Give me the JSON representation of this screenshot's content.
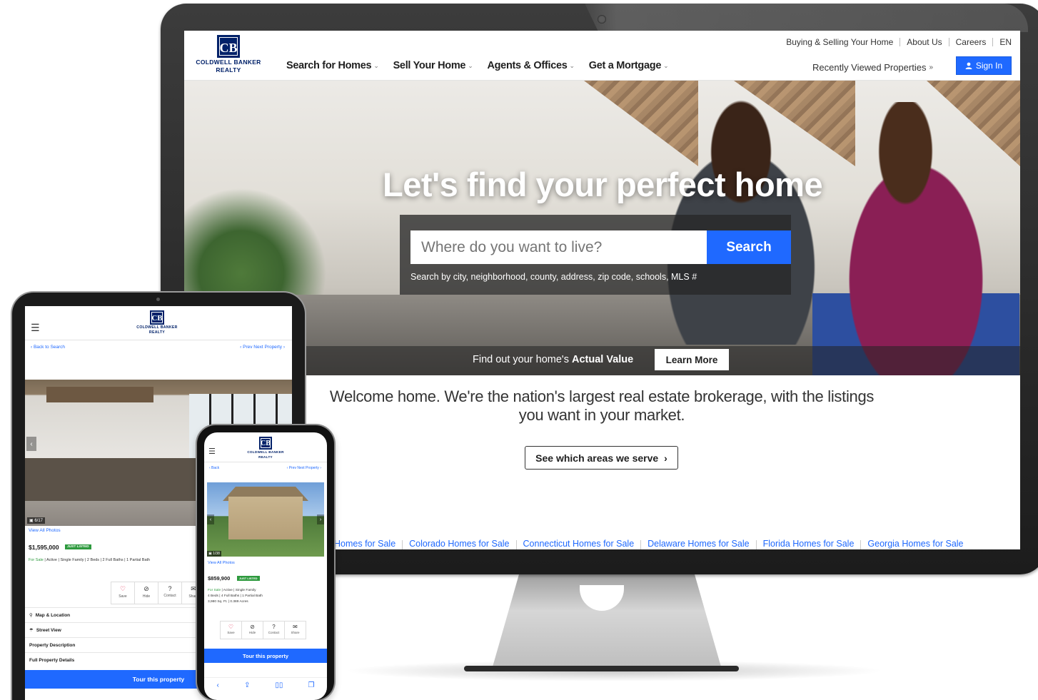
{
  "brand": {
    "logo_mark": "CB",
    "logo_line1": "COLDWELL BANKER",
    "logo_line2": "REALTY",
    "primary_color": "#1f69ff",
    "navy_color": "#012169"
  },
  "desktop": {
    "util_nav": [
      "Buying & Selling Your Home",
      "About Us",
      "Careers",
      "EN"
    ],
    "main_nav": [
      "Search for Homes",
      "Sell Your Home",
      "Agents & Offices",
      "Get a Mortgage"
    ],
    "recently_viewed": "Recently Viewed Properties",
    "recently_viewed_icon": "double-chevron-down-icon",
    "sign_in": "Sign In",
    "sign_in_icon": "user-icon",
    "hero_title": "Let's find your perfect home",
    "search": {
      "placeholder": "Where do you want to live?",
      "button": "Search",
      "hint": "Search by city, neighborhood, county, address, zip code, schools, MLS #"
    },
    "value_prefix": "Find out your home's ",
    "value_bold": "Actual Value",
    "learn_more": "Learn More",
    "welcome": "Welcome home. We're the nation's largest real estate brokerage, with the listings you want in your market.",
    "areas_button": "See which areas we serve",
    "state_links": [
      "Homes for Sale",
      "Colorado Homes for Sale",
      "Connecticut Homes for Sale",
      "Delaware Homes for Sale",
      "Florida Homes for Sale",
      "Georgia Homes for Sale"
    ]
  },
  "tablet": {
    "back": "‹ Back to Search",
    "prev_next": "‹ Prev   Next Property ›",
    "photo_count": "6/17",
    "view_all": "View All Photos",
    "price": "$1,595,000",
    "badge": "JUST LISTED",
    "facts_status": "For Sale",
    "facts_rest": " | Active | Single Family | 2 Beds | 2 Full Baths | 1 Partial Bath",
    "actions": [
      {
        "icon": "heart-icon",
        "label": "Save"
      },
      {
        "icon": "hide-icon",
        "label": "Hide"
      },
      {
        "icon": "question-icon",
        "label": "Contact"
      },
      {
        "icon": "share-icon",
        "label": "Share"
      }
    ],
    "sections": [
      "Map & Location",
      "Street View",
      "Property Description",
      "Full Property Details"
    ],
    "tour": "Tour this property"
  },
  "phone": {
    "back": "‹ Back",
    "prev_next": "‹ Prev   Next Property ›",
    "photo_count": "1/38",
    "view_all": "View All Photos",
    "price": "$859,900",
    "badge": "JUST LISTED",
    "facts_line1_status": "For Sale",
    "facts_line1_rest": " | Active | Single Family",
    "facts_line2": "4 Beds | 4 Full Baths | 1 Partial Bath",
    "facts_line3": "3,980 Sq. Ft. | 0.389 Acres",
    "actions": [
      {
        "icon": "heart-icon",
        "label": "Save"
      },
      {
        "icon": "hide-icon",
        "label": "Hide"
      },
      {
        "icon": "question-icon",
        "label": "Contact"
      },
      {
        "icon": "share-icon",
        "label": "Share"
      }
    ],
    "tour": "Tour this property"
  }
}
